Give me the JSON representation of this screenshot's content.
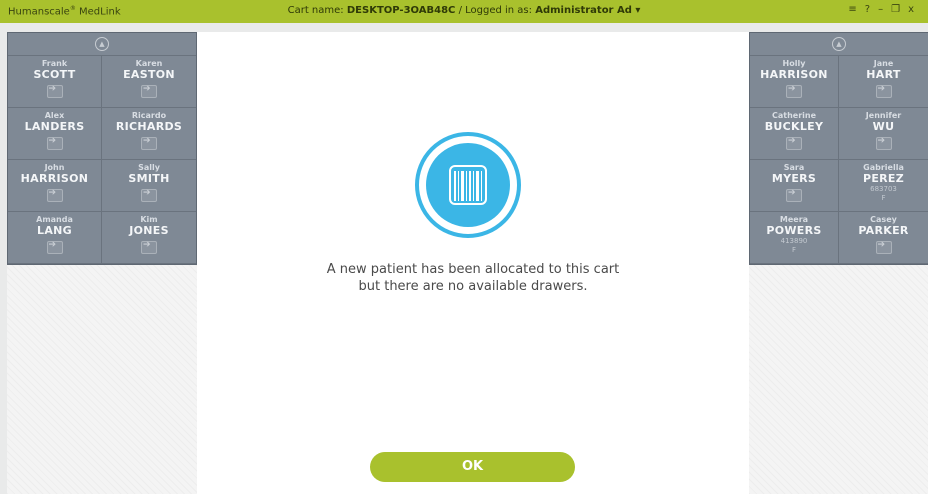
{
  "app": {
    "brand": "Humanscale",
    "brand_reg": "®",
    "brand_product": " MedLink",
    "cart_label": "Cart name:",
    "cart_name": "DESKTOP-3OAB48C",
    "separator": "/",
    "logged_label": "Logged in as:",
    "logged_user": "Administrator Ad",
    "user_dropdown_glyph": "▾",
    "controls": {
      "menu": "≡",
      "help": "?",
      "minimize": "–",
      "restore": "❐",
      "close": "x"
    }
  },
  "left_panel": {
    "patients": [
      {
        "first": "Frank",
        "last": "SCOTT"
      },
      {
        "first": "Karen",
        "last": "EASTON"
      },
      {
        "first": "Alex",
        "last": "LANDERS"
      },
      {
        "first": "Ricardo",
        "last": "RICHARDS"
      },
      {
        "first": "John",
        "last": "HARRISON"
      },
      {
        "first": "Sally",
        "last": "SMITH"
      },
      {
        "first": "Amanda",
        "last": "LANG"
      },
      {
        "first": "Kim",
        "last": "JONES"
      }
    ]
  },
  "right_panel": {
    "patients": [
      {
        "first": "Holly",
        "last": "HARRISON"
      },
      {
        "first": "Jane",
        "last": "HART"
      },
      {
        "first": "Catherine",
        "last": "BUCKLEY"
      },
      {
        "first": "Jennifer",
        "last": "WU"
      },
      {
        "first": "Sara",
        "last": "MYERS"
      },
      {
        "first": "Gabriella",
        "last": "PEREZ",
        "id": "683703",
        "sex": "F"
      },
      {
        "first": "Meera",
        "last": "POWERS",
        "id": "413890",
        "sex": "F"
      },
      {
        "first": "Casey",
        "last": "PARKER"
      }
    ]
  },
  "dialog": {
    "message_line1": "A new patient has been allocated to this cart",
    "message_line2": "but there are no available drawers.",
    "ok_label": "OK",
    "icon": "barcode-scan-icon",
    "accent": "#3bb6e6"
  },
  "colors": {
    "brand": "#a9c12d",
    "panel": "#7f8995"
  }
}
